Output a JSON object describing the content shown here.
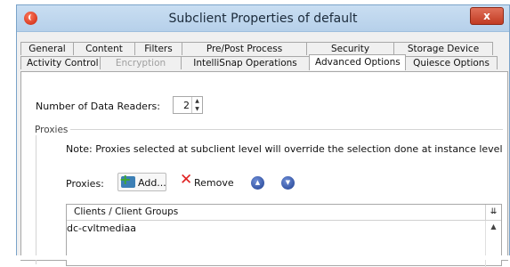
{
  "window": {
    "title": "Subclient Properties of default",
    "close_label": "x"
  },
  "tabs": {
    "row_top": [
      "General",
      "Content",
      "Filters",
      "Pre/Post Process",
      "Security",
      "Storage Device"
    ],
    "row_bottom": [
      "Activity Control",
      "Encryption",
      "IntelliSnap Operations",
      "Advanced Options",
      "Quiesce Options"
    ],
    "active": "Advanced Options",
    "disabled": [
      "Encryption"
    ]
  },
  "readers": {
    "label": "Number of Data Readers:",
    "value": "2"
  },
  "proxies": {
    "group_label": "Proxies",
    "note": "Note: Proxies selected at subclient level will override the selection done at instance level",
    "label": "Proxies:",
    "add_label": "Add...",
    "remove_label": "Remove",
    "list_header": "Clients / Client Groups",
    "items": [
      "dc-cvltmediaa"
    ]
  },
  "icons": {
    "app": "app-logo-icon",
    "add": "add-icon",
    "remove": "remove-x-icon",
    "move_up": "move-up-icon",
    "move_down": "move-down-icon"
  },
  "colors": {
    "titlebar": "#b6d0ea",
    "close": "#c13b22",
    "remove": "#e02020"
  }
}
